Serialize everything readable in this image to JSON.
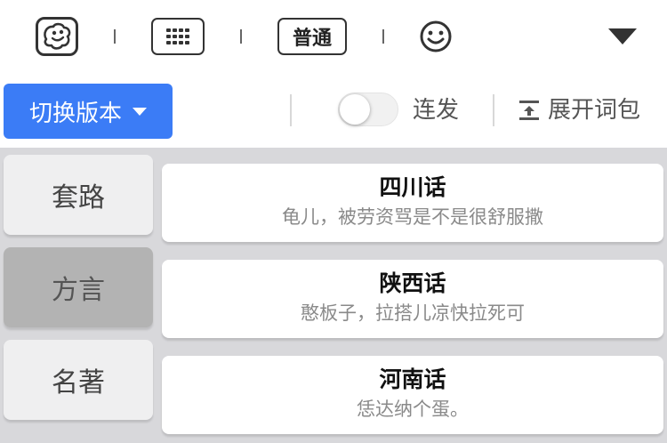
{
  "toolbar": {
    "mascot_icon": "mascot-logo-icon",
    "grid_icon": "keyboard-grid-icon",
    "mode_label": "普通",
    "emoji_icon": "smiley-icon",
    "dropdown_icon": "triangle-down-icon"
  },
  "actions": {
    "switch_version_label": "切换版本",
    "burst_toggle_on": false,
    "burst_label": "连发",
    "expand_label": "展开词包"
  },
  "categories": [
    {
      "label": "套路",
      "active": false
    },
    {
      "label": "方言",
      "active": true
    },
    {
      "label": "名著",
      "active": false
    }
  ],
  "phrases": [
    {
      "title": "四川话",
      "text": "龟儿，被劳资骂是不是很舒服撒"
    },
    {
      "title": "陕西话",
      "text": "憨板子，拉搭儿凉快拉死可"
    },
    {
      "title": "河南话",
      "text": "恁达纳个蛋。"
    }
  ],
  "colors": {
    "accent": "#3b7cf6",
    "content_bg": "#d8d8db",
    "active_category_bg": "#b3b3b3"
  }
}
